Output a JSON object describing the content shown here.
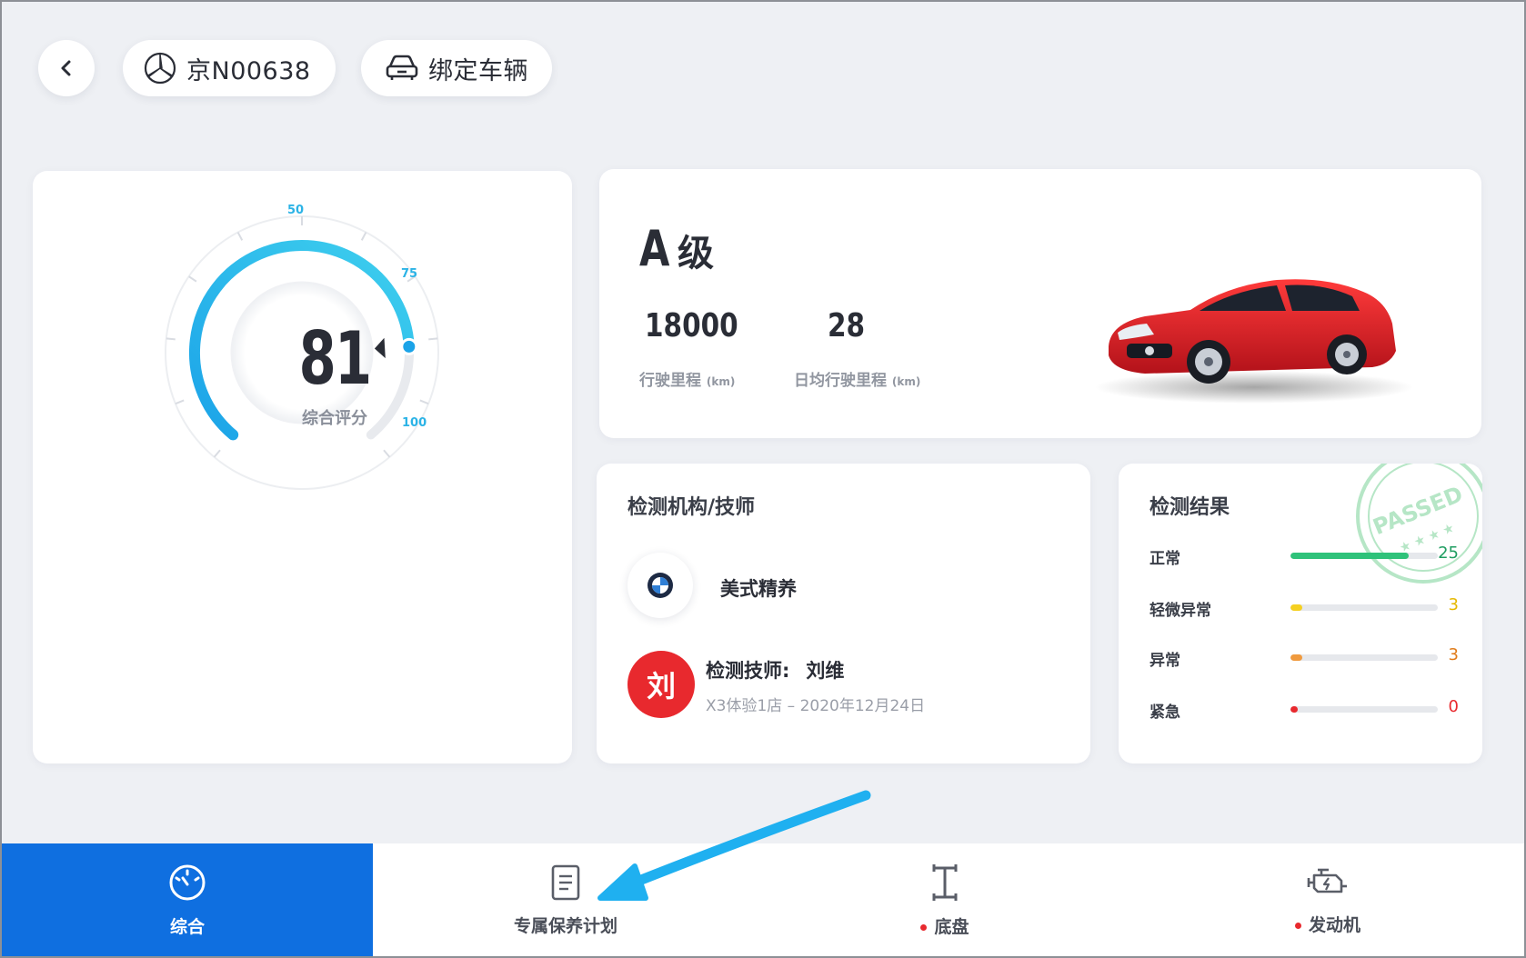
{
  "header": {
    "plate": "京N00638",
    "bind_label": "绑定车辆"
  },
  "score": {
    "value": "81",
    "label": "综合评分",
    "scale_ticks": [
      "50",
      "75",
      "100"
    ],
    "fraction": 0.81
  },
  "grade": {
    "letter": "A",
    "suffix": "级",
    "mileage_value": "18000",
    "mileage_label": "行驶里程",
    "mileage_unit": "(km)",
    "daily_value": "28",
    "daily_label": "日均行驶里程",
    "daily_unit": "(km)"
  },
  "org": {
    "title": "检测机构/技师",
    "name": "美式精养",
    "tech_avatar": "刘",
    "tech_label": "检测技师:",
    "tech_name": "刘维",
    "tech_sub": "X3体验1店 – 2020年12月24日"
  },
  "result": {
    "title": "检测结果",
    "stamp_text": "PASSED",
    "rows": [
      {
        "label": "正常",
        "count": "25",
        "fraction": 0.8,
        "color": "#2fc27a",
        "count_color": "#1f9d61"
      },
      {
        "label": "轻微异常",
        "count": "3",
        "fraction": 0.08,
        "color": "#f5d020",
        "count_color": "#e6b800"
      },
      {
        "label": "异常",
        "count": "3",
        "fraction": 0.08,
        "color": "#f09a3e",
        "count_color": "#e07b1a"
      },
      {
        "label": "紧急",
        "count": "0",
        "fraction": 0.05,
        "color": "#e8292e",
        "count_color": "#e8292e"
      }
    ]
  },
  "nav": {
    "tabs": [
      {
        "label": "综合",
        "icon": "speedometer-icon",
        "active": true,
        "dot": false
      },
      {
        "label": "专属保养计划",
        "icon": "document-icon",
        "active": false,
        "dot": false
      },
      {
        "label": "底盘",
        "icon": "chassis-icon",
        "active": false,
        "dot": true
      },
      {
        "label": "发动机",
        "icon": "engine-icon",
        "active": false,
        "dot": true
      }
    ]
  },
  "colors": {
    "accent_blue": "#0f6fe0",
    "gauge_blue": "#2bb3e6",
    "alert_red": "#e8292e",
    "background": "#eef0f4"
  }
}
